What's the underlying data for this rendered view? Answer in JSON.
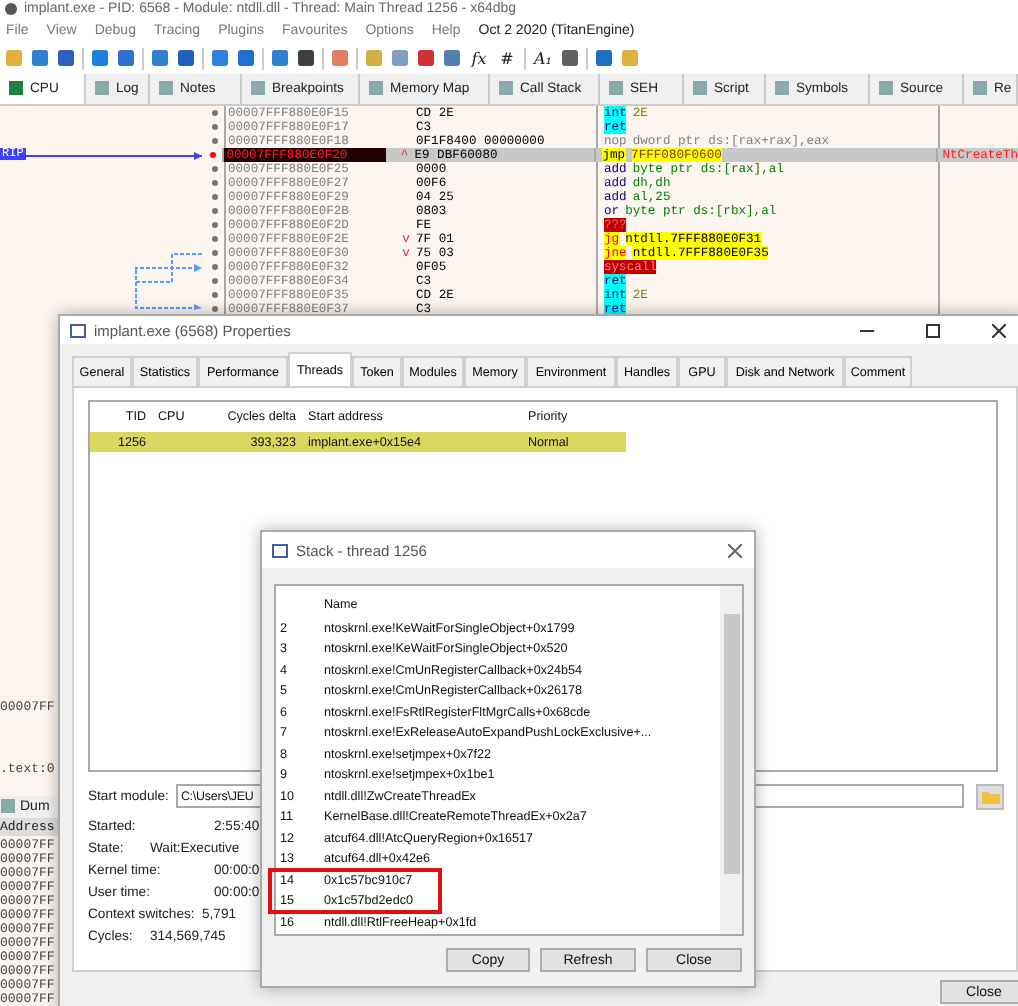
{
  "debugger": {
    "title": "implant.exe - PID: 6568 - Module: ntdll.dll - Thread: Main Thread 1256 - x64dbg",
    "menu": [
      "File",
      "View",
      "Debug",
      "Tracing",
      "Plugins",
      "Favourites",
      "Options",
      "Help"
    ],
    "build_info": "Oct 2 2020 (TitanEngine)",
    "toolbar": [
      {
        "kind": "icon"
      },
      {
        "kind": "icon"
      },
      {
        "kind": "icon"
      },
      {
        "kind": "sep"
      },
      {
        "kind": "icon"
      },
      {
        "kind": "icon"
      },
      {
        "kind": "sep"
      },
      {
        "kind": "icon"
      },
      {
        "kind": "icon"
      },
      {
        "kind": "sep"
      },
      {
        "kind": "icon"
      },
      {
        "kind": "icon"
      },
      {
        "kind": "sep"
      },
      {
        "kind": "icon"
      },
      {
        "kind": "icon"
      },
      {
        "kind": "sep"
      },
      {
        "kind": "icon"
      },
      {
        "kind": "sep"
      },
      {
        "kind": "icon"
      },
      {
        "kind": "icon"
      },
      {
        "kind": "icon"
      },
      {
        "kind": "icon"
      },
      {
        "kind": "glyph",
        "text": "fx"
      },
      {
        "kind": "glyph",
        "text": "#"
      },
      {
        "kind": "sep"
      },
      {
        "kind": "glyph",
        "text": "A₁"
      },
      {
        "kind": "icon"
      },
      {
        "kind": "sep"
      },
      {
        "kind": "icon"
      },
      {
        "kind": "icon"
      }
    ],
    "tabs": [
      {
        "label": "CPU",
        "selected": true
      },
      {
        "label": "Log",
        "selected": false
      },
      {
        "label": "Notes",
        "selected": false
      },
      {
        "label": "Breakpoints",
        "selected": false
      },
      {
        "label": "Memory Map",
        "selected": false
      },
      {
        "label": "Call Stack",
        "selected": false
      },
      {
        "label": "SEH",
        "selected": false
      },
      {
        "label": "Script",
        "selected": false
      },
      {
        "label": "Symbols",
        "selected": false
      },
      {
        "label": "Source",
        "selected": false
      },
      {
        "label": "Re",
        "selected": false
      }
    ],
    "rip_label": "RIP",
    "disassembly": [
      {
        "address": "00007FFF880E0F15",
        "bytes": "CD 2E",
        "mnemonic": "int",
        "operands": "2E",
        "kind": "interrupt",
        "selected": false
      },
      {
        "address": "00007FFF880E0F17",
        "bytes": "C3",
        "mnemonic": "ret",
        "kind": "return",
        "selected": false
      },
      {
        "address": "00007FFF880E0F18",
        "bytes": "0F1F8400 00000000",
        "mnemonic": "nop",
        "operands": "dword ptr ds:[rax+rax],eax",
        "kind": "nop",
        "selected": false
      },
      {
        "address": "00007FFF880E0F20",
        "bytes": "E9 DBF60080",
        "branch": "^",
        "mnemonic": "jmp",
        "operands": "7FFF080F0600",
        "kind": "jump",
        "selected": true,
        "comment": "NtCreateTh"
      },
      {
        "address": "00007FFF880E0F25",
        "bytes": "0000",
        "mnemonic": "add",
        "operands": "byte ptr ds:[rax],al",
        "kind": "plain",
        "selected": false
      },
      {
        "address": "00007FFF880E0F27",
        "bytes": "00F6",
        "mnemonic": "add",
        "operands": "dh,dh",
        "kind": "plain",
        "selected": false
      },
      {
        "address": "00007FFF880E0F29",
        "bytes": "04 25",
        "mnemonic": "add",
        "operands": "al,25",
        "kind": "plain",
        "selected": false
      },
      {
        "address": "00007FFF880E0F2B",
        "bytes": "0803",
        "mnemonic": "or",
        "operands": "byte ptr ds:[rbx],al",
        "kind": "plain",
        "selected": false
      },
      {
        "address": "00007FFF880E0F2D",
        "bytes": "FE",
        "mnemonic": "???",
        "kind": "invalid",
        "selected": false
      },
      {
        "address": "00007FFF880E0F2E",
        "bytes": "7F 01",
        "branch": "v",
        "mnemonic": "jg",
        "operands": "ntdll.7FFF880E0F31",
        "kind": "cond_jump",
        "selected": false
      },
      {
        "address": "00007FFF880E0F30",
        "bytes": "75 03",
        "branch": "v",
        "mnemonic": "jne",
        "operands": "ntdll.7FFF880E0F35",
        "kind": "cond_jump",
        "selected": false
      },
      {
        "address": "00007FFF880E0F32",
        "bytes": "0F05",
        "mnemonic": "syscall",
        "kind": "syscall",
        "selected": false
      },
      {
        "address": "00007FFF880E0F34",
        "bytes": "C3",
        "mnemonic": "ret",
        "kind": "return",
        "selected": false
      },
      {
        "address": "00007FFF880E0F35",
        "bytes": "CD 2E",
        "mnemonic": "int",
        "operands": "2E",
        "kind": "interrupt",
        "selected": false
      },
      {
        "address": "00007FFF880E0F37",
        "bytes": "C3",
        "mnemonic": "ret",
        "kind": "return",
        "selected": false
      }
    ],
    "info_line": "00007FF",
    "section_line": ".text:0",
    "dump_tab": "Dum",
    "dump_header": "Address",
    "dump_rows": [
      "00007FF",
      "00007FF",
      "00007FF",
      "00007FF",
      "00007FF",
      "00007FF",
      "00007FF",
      "00007FF",
      "00007FF",
      "00007FF",
      "00007FF",
      "00007FF"
    ]
  },
  "properties": {
    "title": "implant.exe (6568) Properties",
    "tabs": [
      {
        "label": "General",
        "selected": false
      },
      {
        "label": "Statistics",
        "selected": false
      },
      {
        "label": "Performance",
        "selected": false
      },
      {
        "label": "Threads",
        "selected": true
      },
      {
        "label": "Token",
        "selected": false
      },
      {
        "label": "Modules",
        "selected": false
      },
      {
        "label": "Memory",
        "selected": false
      },
      {
        "label": "Environment",
        "selected": false
      },
      {
        "label": "Handles",
        "selected": false
      },
      {
        "label": "GPU",
        "selected": false
      },
      {
        "label": "Disk and Network",
        "selected": false
      },
      {
        "label": "Comment",
        "selected": false
      }
    ],
    "columns": [
      "TID",
      "CPU",
      "Cycles delta",
      "Start address",
      "Priority"
    ],
    "rows": [
      {
        "tid": "1256",
        "cycles_delta": "393,323",
        "start_address": "implant.exe+0x15e4",
        "priority": "Normal",
        "selected": true
      }
    ],
    "start_module_label": "Start module:",
    "start_module_value": "C:\\Users\\JEU",
    "details": [
      {
        "label": "Started:",
        "value": "2:55:40"
      },
      {
        "label": "State:",
        "value": "Wait:Executive"
      },
      {
        "label": "Kernel time:",
        "value": "00:00:0"
      },
      {
        "label": "User time:",
        "value": "00:00:0"
      },
      {
        "label": "Context switches:",
        "value": "5,791"
      },
      {
        "label": "Cycles:",
        "value": "314,569,745"
      }
    ],
    "close_button": "Close"
  },
  "stack": {
    "title": "Stack - thread 1256",
    "column": "Name",
    "frames": [
      {
        "index": "2",
        "name": "ntoskrnl.exe!KeWaitForSingleObject+0x1799",
        "boxed": false
      },
      {
        "index": "3",
        "name": "ntoskrnl.exe!KeWaitForSingleObject+0x520",
        "boxed": false
      },
      {
        "index": "4",
        "name": "ntoskrnl.exe!CmUnRegisterCallback+0x24b54",
        "boxed": false
      },
      {
        "index": "5",
        "name": "ntoskrnl.exe!CmUnRegisterCallback+0x26178",
        "boxed": false
      },
      {
        "index": "6",
        "name": "ntoskrnl.exe!FsRtlRegisterFltMgrCalls+0x68cde",
        "boxed": false
      },
      {
        "index": "7",
        "name": "ntoskrnl.exe!ExReleaseAutoExpandPushLockExclusive+...",
        "boxed": false
      },
      {
        "index": "8",
        "name": "ntoskrnl.exe!setjmpex+0x7f22",
        "boxed": false
      },
      {
        "index": "9",
        "name": "ntoskrnl.exe!setjmpex+0x1be1",
        "boxed": false
      },
      {
        "index": "10",
        "name": "ntdll.dll!ZwCreateThreadEx",
        "boxed": false
      },
      {
        "index": "11",
        "name": "KernelBase.dll!CreateRemoteThreadEx+0x2a7",
        "boxed": false
      },
      {
        "index": "12",
        "name": "atcuf64.dll!AtcQueryRegion+0x16517",
        "boxed": false
      },
      {
        "index": "13",
        "name": "atcuf64.dll+0x42e6",
        "boxed": false
      },
      {
        "index": "14",
        "name": "0x1c57bc910c7",
        "boxed": true
      },
      {
        "index": "15",
        "name": "0x1c57bd2edc0",
        "boxed": true
      },
      {
        "index": "16",
        "name": "ntdll.dll!RtlFreeHeap+0x1fd",
        "boxed": false
      }
    ],
    "buttons": [
      "Copy",
      "Refresh",
      "Close"
    ]
  }
}
